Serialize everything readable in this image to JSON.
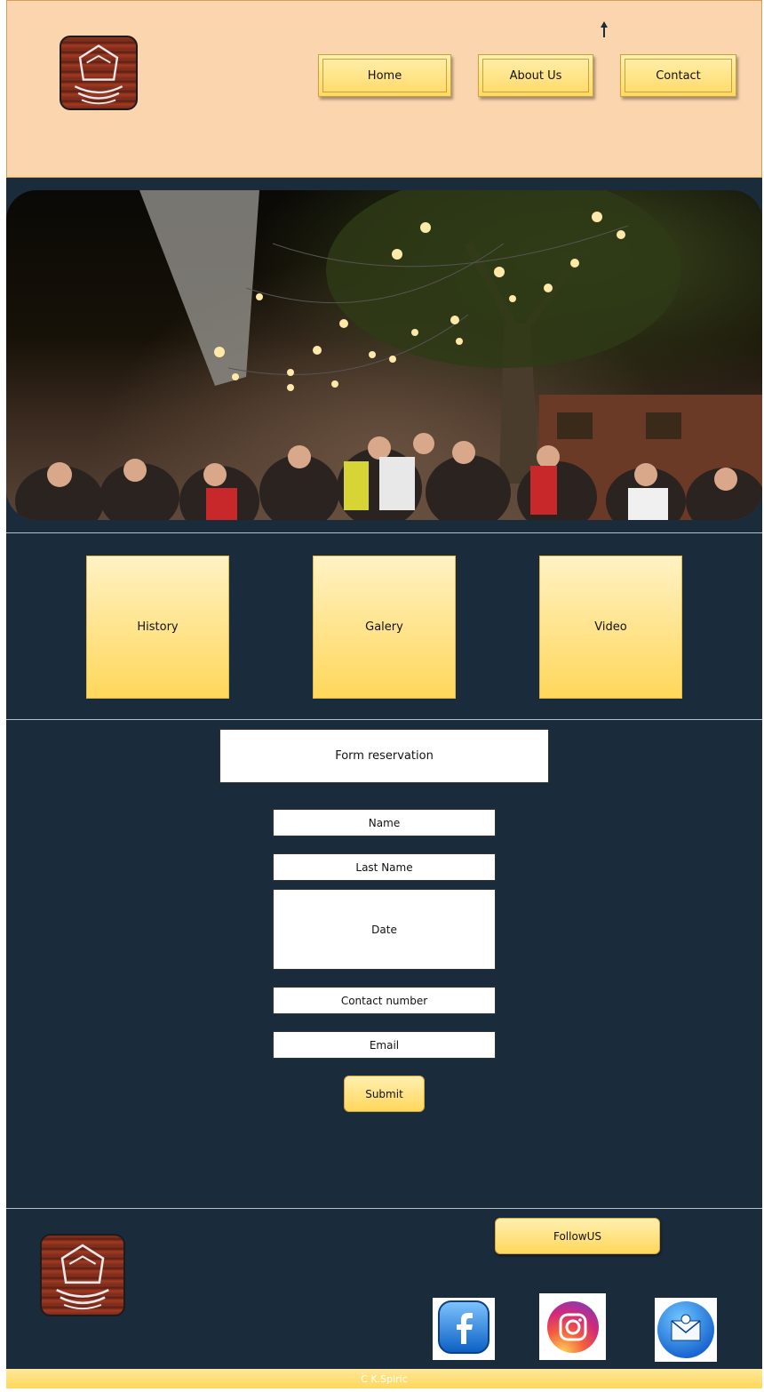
{
  "header": {
    "logo_icon": "crown-book-logo",
    "nav": [
      {
        "label": "Home"
      },
      {
        "label": "About Us"
      },
      {
        "label": "Contact"
      }
    ]
  },
  "hero": {
    "image": "outdoor-party-string-lights-photo"
  },
  "tiles": [
    {
      "label": "History"
    },
    {
      "label": "Galery"
    },
    {
      "label": "Video"
    }
  ],
  "form": {
    "title": "Form reservation",
    "fields": [
      {
        "label": "Name"
      },
      {
        "label": "Last Name"
      },
      {
        "label": "Date"
      },
      {
        "label": "Contact number"
      },
      {
        "label": "Email"
      }
    ],
    "submit_label": "Submit"
  },
  "footer": {
    "follow_label": "FollowUS",
    "social": [
      {
        "icon": "facebook-icon"
      },
      {
        "icon": "instagram-icon"
      },
      {
        "icon": "email-icon"
      }
    ],
    "copyright": "C K.Spiric"
  },
  "colors": {
    "header_bg": "#fad5ae",
    "section_bg": "#1a2b3c",
    "button_gold": "#ffd75a"
  }
}
